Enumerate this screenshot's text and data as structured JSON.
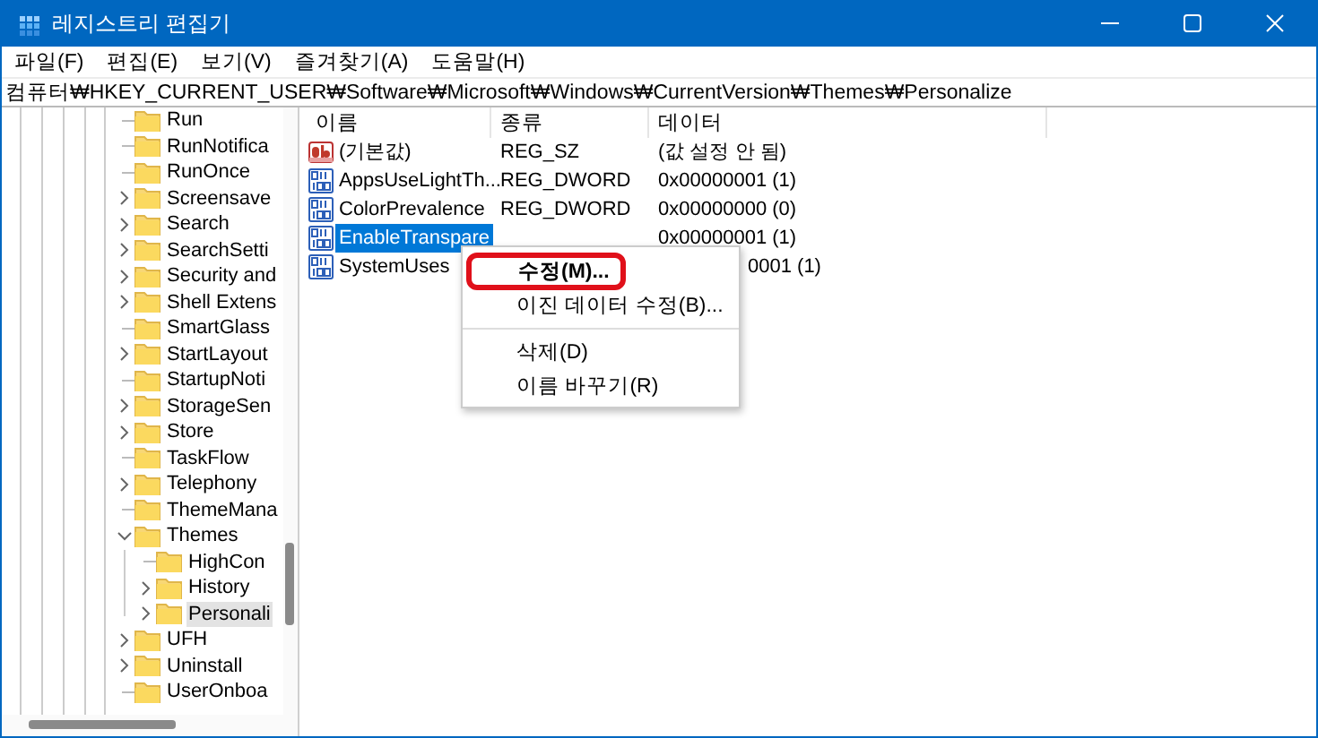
{
  "window": {
    "title": "레지스트리 편집기"
  },
  "menu": [
    "파일(F)",
    "편집(E)",
    "보기(V)",
    "즐겨찾기(A)",
    "도움말(H)"
  ],
  "address": "컴퓨터₩HKEY_CURRENT_USER₩Software₩Microsoft₩Windows₩CurrentVersion₩Themes₩Personalize",
  "tree": [
    {
      "label": "Run",
      "kind": "leaf",
      "selected": false
    },
    {
      "label": "RunNotifica",
      "kind": "leaf",
      "selected": false
    },
    {
      "label": "RunOnce",
      "kind": "leaf",
      "selected": false
    },
    {
      "label": "Screensave",
      "kind": "branch",
      "expanded": false,
      "selected": false
    },
    {
      "label": "Search",
      "kind": "branch",
      "expanded": false,
      "selected": false
    },
    {
      "label": "SearchSetti",
      "kind": "branch",
      "expanded": false,
      "selected": false
    },
    {
      "label": "Security and",
      "kind": "branch",
      "expanded": false,
      "selected": false
    },
    {
      "label": "Shell Extens",
      "kind": "branch",
      "expanded": false,
      "selected": false
    },
    {
      "label": "SmartGlass",
      "kind": "leaf",
      "selected": false
    },
    {
      "label": "StartLayout",
      "kind": "branch",
      "expanded": false,
      "selected": false
    },
    {
      "label": "StartupNoti",
      "kind": "leaf",
      "selected": false
    },
    {
      "label": "StorageSen",
      "kind": "branch",
      "expanded": false,
      "selected": false
    },
    {
      "label": "Store",
      "kind": "branch",
      "expanded": false,
      "selected": false
    },
    {
      "label": "TaskFlow",
      "kind": "leaf",
      "selected": false
    },
    {
      "label": "Telephony",
      "kind": "branch",
      "expanded": false,
      "selected": false
    },
    {
      "label": "ThemeMana",
      "kind": "leaf",
      "selected": false
    },
    {
      "label": "Themes",
      "kind": "branch",
      "expanded": true,
      "selected": false,
      "children": [
        {
          "label": "HighCon",
          "kind": "leaf",
          "selected": false
        },
        {
          "label": "History",
          "kind": "branch",
          "expanded": false,
          "selected": false
        },
        {
          "label": "Personali",
          "kind": "branch",
          "expanded": false,
          "selected": true
        }
      ]
    },
    {
      "label": "UFH",
      "kind": "branch",
      "expanded": false,
      "selected": false
    },
    {
      "label": "Uninstall",
      "kind": "branch",
      "expanded": false,
      "selected": false
    },
    {
      "label": "UserOnboa",
      "kind": "leaf",
      "selected": false
    }
  ],
  "list": {
    "columns": [
      "이름",
      "종류",
      "데이터"
    ],
    "rows": [
      {
        "kind": "string",
        "name": "(기본값)",
        "type": "REG_SZ",
        "data": "(값 설정 안 됨)",
        "selected": false
      },
      {
        "kind": "dword",
        "name": "AppsUseLightTh...",
        "type": "REG_DWORD",
        "data": "0x00000001 (1)",
        "selected": false
      },
      {
        "kind": "dword",
        "name": "ColorPrevalence",
        "type": "REG_DWORD",
        "data": "0x00000000 (0)",
        "selected": false
      },
      {
        "kind": "dword",
        "name": "EnableTranspare",
        "data": "0x00000001 (1)",
        "selected": true
      },
      {
        "kind": "dword",
        "name": "SystemUses",
        "data": "0001 (1)",
        "data_cut": true,
        "selected": false
      }
    ]
  },
  "context_menu": {
    "items": [
      {
        "kind": "item",
        "label": "수정(M)...",
        "bold": true,
        "circled": true
      },
      {
        "kind": "item",
        "label": "이진 데이터 수정(B)...",
        "bold": false,
        "circled": false
      },
      {
        "kind": "separator"
      },
      {
        "kind": "item",
        "label": "삭제(D)",
        "bold": false,
        "circled": false
      },
      {
        "kind": "item",
        "label": "이름 바꾸기(R)",
        "bold": false,
        "circled": false
      }
    ]
  }
}
